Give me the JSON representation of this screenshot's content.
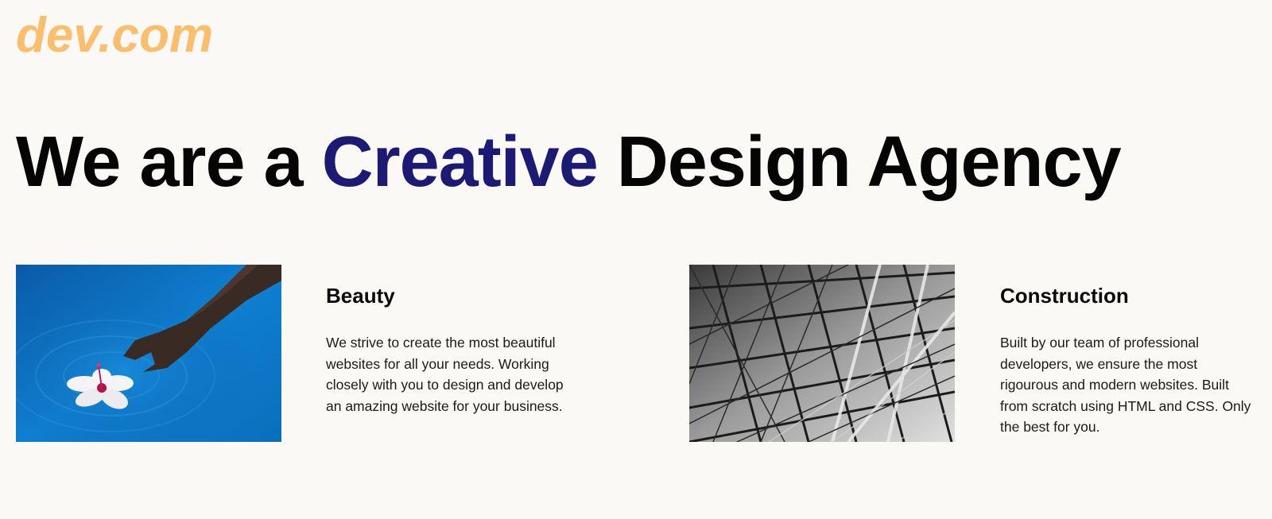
{
  "header": {
    "logo_text": "dev.com",
    "logo_color": "#fbbe6d"
  },
  "hero": {
    "prefix": "We are a ",
    "accent": "Creative",
    "suffix": " Design Agency",
    "accent_color": "#1c1a73"
  },
  "features": [
    {
      "title": "Beauty",
      "text": "We strive to create the most beautiful websites for all your needs. Working closely with you to design and develop an amazing website for your business.",
      "image": "hand-in-water-with-flower-photo"
    },
    {
      "title": "Construction",
      "text": "Built by our team of professional developers, we ensure the most rigourous and modern websites. Built from scratch using HTML and CSS. Only the best for you.",
      "image": "steel-scaffolding-photo"
    }
  ],
  "colors": {
    "background": "#faf9f6",
    "text": "#111111"
  }
}
